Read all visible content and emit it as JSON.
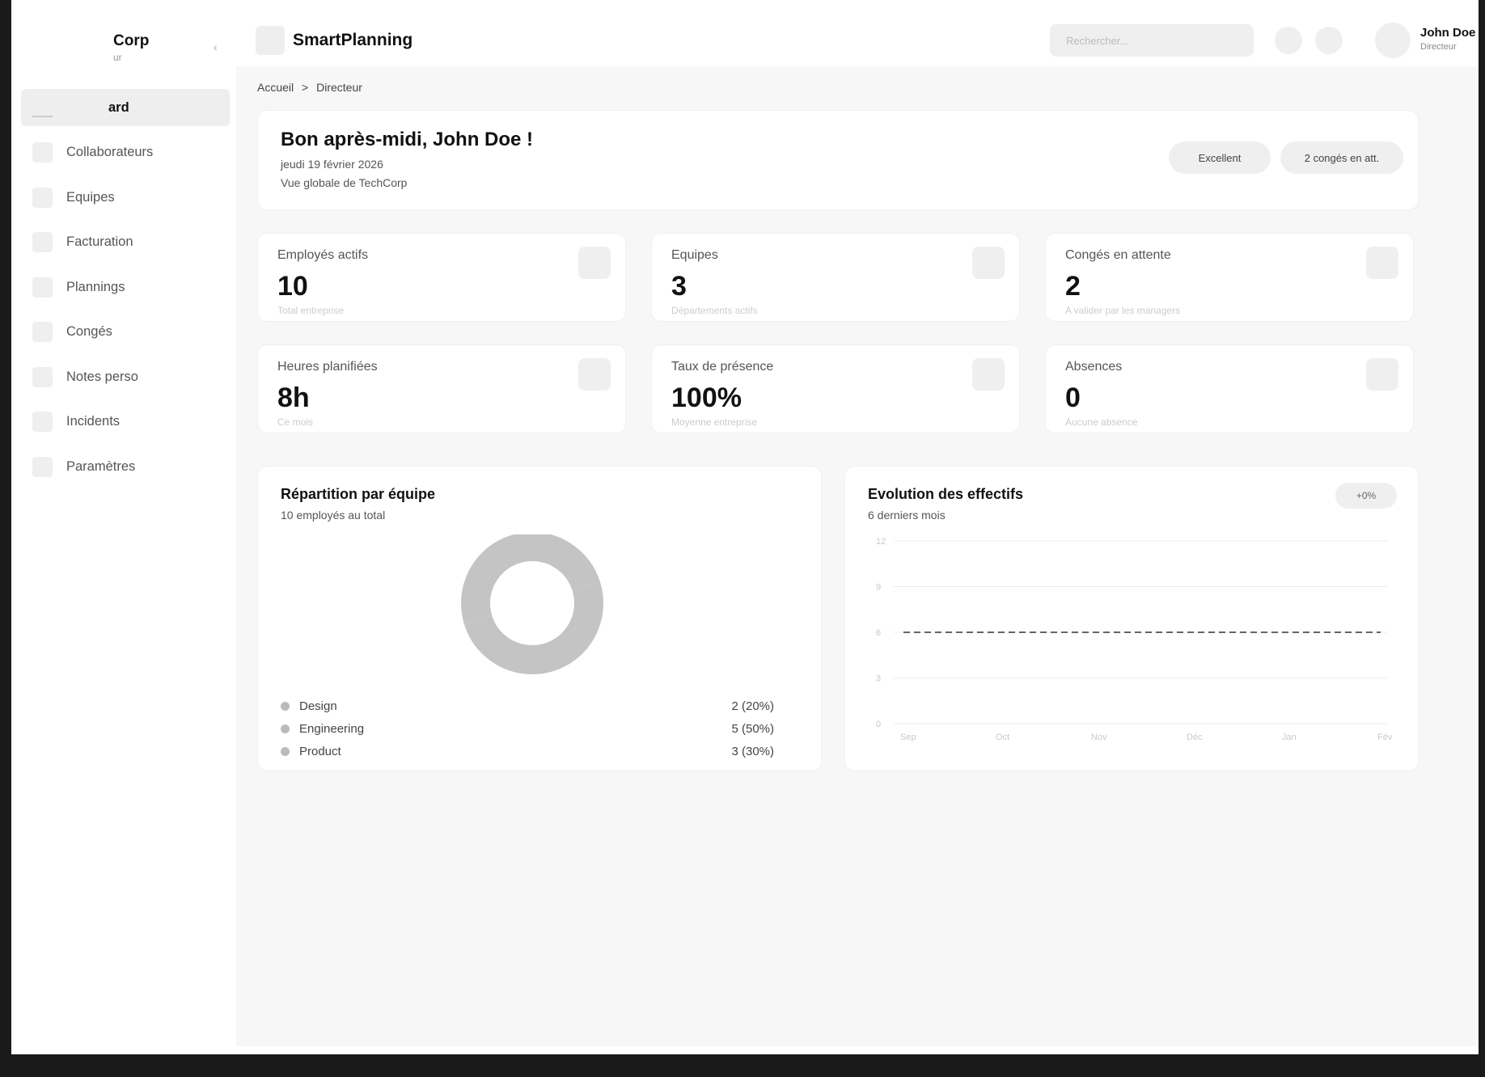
{
  "sidebar": {
    "brand_name": "Corp",
    "brand_sub": "ur",
    "collapse_glyph": "‹",
    "items": [
      {
        "label": "ard",
        "icon": "dashboard-icon"
      },
      {
        "label": "Collaborateurs",
        "icon": "users-icon"
      },
      {
        "label": "Equipes",
        "icon": "team-icon"
      },
      {
        "label": "Facturation",
        "icon": "billing-icon"
      },
      {
        "label": "Plannings",
        "icon": "calendar-icon"
      },
      {
        "label": "Congés",
        "icon": "leave-icon"
      },
      {
        "label": "Notes perso",
        "icon": "notes-icon"
      },
      {
        "label": "Incidents",
        "icon": "incident-icon"
      },
      {
        "label": "Paramètres",
        "icon": "settings-icon"
      }
    ]
  },
  "header": {
    "app_title": "SmartPlanning",
    "search_placeholder": "Rechercher...",
    "user_name": "John Doe",
    "user_role": "Directeur"
  },
  "breadcrumb": [
    "Accueil",
    ">",
    "Directeur"
  ],
  "welcome": {
    "title": "Bon après-midi, John Doe !",
    "date": "jeudi 19 février 2026",
    "subtitle": "Vue globale de TechCorp",
    "pill_status": "Excellent",
    "pill_leaves": "2 congés en att."
  },
  "stats": [
    {
      "label": "Employés actifs",
      "value": "10",
      "sub": "Total entreprise"
    },
    {
      "label": "Equipes",
      "value": "3",
      "sub": "Départements actifs"
    },
    {
      "label": "Congés en attente",
      "value": "2",
      "sub": "A valider par les managers"
    },
    {
      "label": "Heures planifiées",
      "value": "8h",
      "sub": "Ce mois"
    },
    {
      "label": "Taux de présence",
      "value": "100%",
      "sub": "Moyenne entreprise"
    },
    {
      "label": "Absences",
      "value": "0",
      "sub": "Aucune absence"
    }
  ],
  "chart_data": [
    {
      "type": "pie",
      "title": "Répartition par équipe",
      "subtitle": "10 employés au total",
      "categories": [
        "Design",
        "Engineering",
        "Product"
      ],
      "values": [
        2,
        5,
        3
      ],
      "value_labels": [
        "2 (20%)",
        "5 (50%)",
        "3 (30%)"
      ]
    },
    {
      "type": "line",
      "title": "Evolution des effectifs",
      "subtitle": "6 derniers mois",
      "badge": "+0%",
      "categories": [
        "Sep",
        "Oct",
        "Nov",
        "Déc",
        "Jan",
        "Fév"
      ],
      "series": [
        {
          "values": [
            6,
            6,
            6,
            6,
            6,
            6
          ]
        }
      ],
      "yticks": [
        "12",
        "9",
        "6",
        "3",
        "0"
      ],
      "ylim": [
        0,
        12
      ],
      "line_style": "dashed",
      "grid": true
    }
  ]
}
